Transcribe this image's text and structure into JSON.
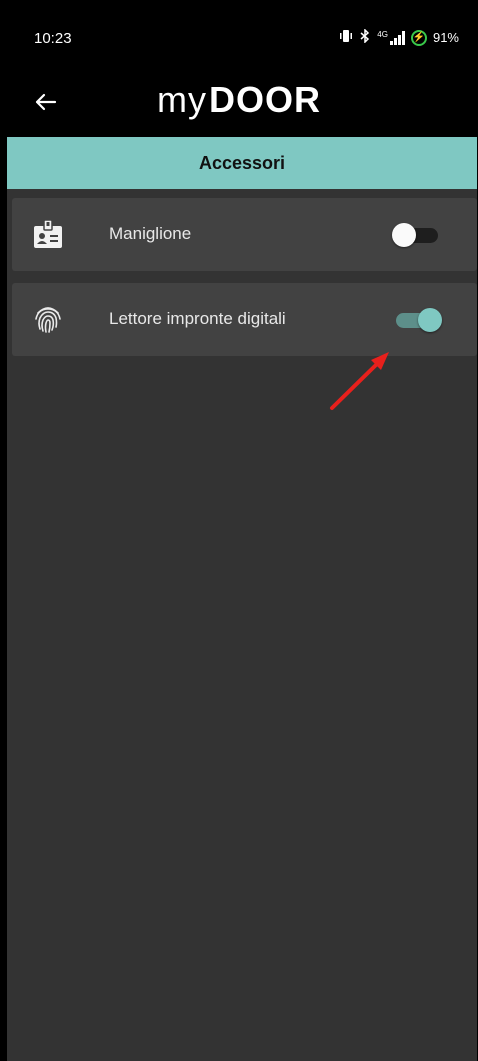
{
  "status_bar": {
    "time": "10:23",
    "network": "4G",
    "battery": "91%"
  },
  "app_bar": {
    "logo_my": "my",
    "logo_door": "DOOR"
  },
  "section": {
    "title": "Accessori"
  },
  "accessories": [
    {
      "label": "Maniglione",
      "icon": "badge-icon",
      "enabled": false
    },
    {
      "label": "Lettore impronte digitali",
      "icon": "fingerprint-icon",
      "enabled": true
    }
  ],
  "colors": {
    "accent": "#7fc8c2",
    "background": "#333333",
    "card": "#424242",
    "annotation_arrow": "#e8201c"
  }
}
